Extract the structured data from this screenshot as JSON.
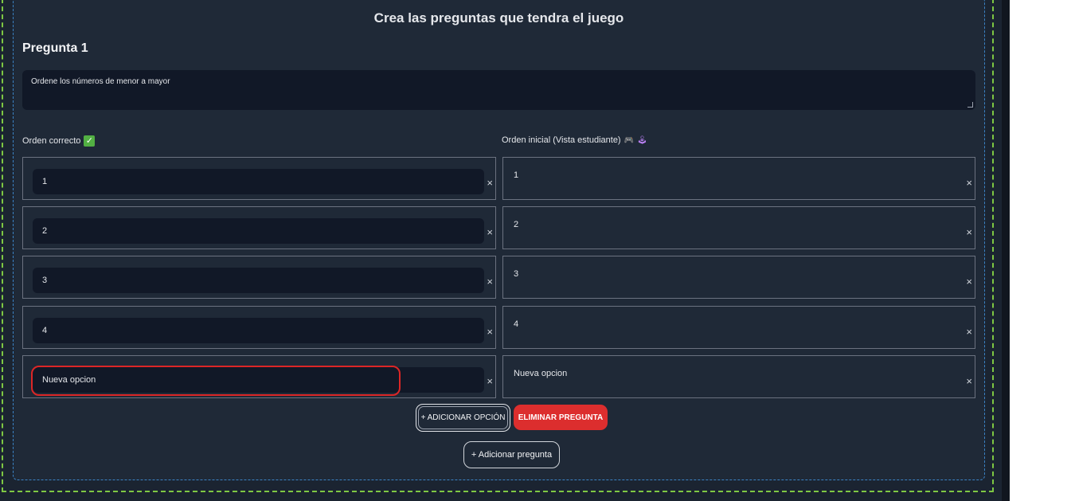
{
  "editor": {
    "heading": "Crea las preguntas que tendra el juego",
    "question_title": "Pregunta 1",
    "question_text": "Ordene los números de menor a mayor",
    "left_label": "Orden correcto",
    "left_icon": "check-mark-icon",
    "right_label": "Orden inicial (Vista estudiante)",
    "right_icons": [
      "gamepad-icon",
      "joystick-icon"
    ],
    "correct_order": [
      "1",
      "2",
      "3",
      "4",
      "Nueva opcion"
    ],
    "initial_order": [
      "1",
      "2",
      "3",
      "4",
      "Nueva opcion"
    ],
    "remove_glyph": "×",
    "add_option_button": "+ ADICIONAR OPCIÓN",
    "delete_question_button": "ELIMINAR PREGUNTA",
    "add_question_button": "+ Adicionar pregunta"
  },
  "colors": {
    "background": "#1b2431",
    "panel": "#1f2937",
    "input": "#111827",
    "danger": "#dc2e2e",
    "outer_dashed_border": "#7ec843",
    "inner_dashed_border": "#3b82c4",
    "highlight": "#dc2626"
  }
}
